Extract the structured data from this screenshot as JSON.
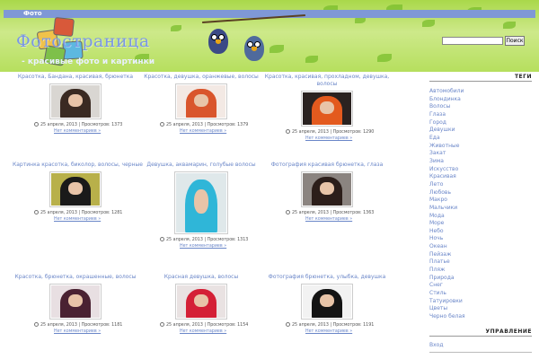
{
  "nav": {
    "items": [
      "Фото"
    ]
  },
  "header": {
    "site_title": "Фотостраница",
    "site_subtitle": "- красивые фото и картинки"
  },
  "search": {
    "placeholder": "",
    "button_label": "Поиск"
  },
  "posts": [
    {
      "title": "Красотка, Бандана, красивая, брюнетка",
      "date": "25 апреля, 2013",
      "views_label": "Просмотров:",
      "views": "1373",
      "comments": "Нет комментариев »",
      "hair_color": "#3a2a22",
      "bg_color": "#d9d6d2"
    },
    {
      "title": "Красотка, девушка, оранжевые, волосы",
      "date": "25 апреля, 2013",
      "views_label": "Просмотров:",
      "views": "1379",
      "comments": "Нет комментариев »",
      "hair_color": "#d9552c",
      "bg_color": "#f3e9e4"
    },
    {
      "title": "Красотка, красивая, прохладном, девушка, волосы",
      "date": "25 апреля, 2013",
      "views_label": "Просмотров:",
      "views": "1290",
      "comments": "Нет комментариев »",
      "hair_color": "#e35a1e",
      "bg_color": "#2a2220"
    },
    {
      "title": "Картинка красотка, биколор, волосы, черные",
      "date": "25 апреля, 2013",
      "views_label": "Просмотров:",
      "views": "1281",
      "comments": "Нет комментариев »",
      "hair_color": "#1a1a1a",
      "bg_color": "#b8b04a"
    },
    {
      "title": "Девушка, аквамарин, голубые волосы",
      "date": "25 апреля, 2013",
      "views_label": "Просмотров:",
      "views": "1313",
      "comments": "Нет комментариев »",
      "hair_color": "#2fb6d8",
      "bg_color": "#dfe8ea"
    },
    {
      "title": "Фотография красивая брюнетка, глаза",
      "date": "25 апреля, 2013",
      "views_label": "Просмотров:",
      "views": "1363",
      "comments": "Нет комментариев »",
      "hair_color": "#2c1e1a",
      "bg_color": "#8b8480"
    },
    {
      "title": "Красотка, брюнетка, окрашенные, волосы",
      "date": "25 апреля, 2013",
      "views_label": "Просмотров:",
      "views": "1181",
      "comments": "Нет комментариев »",
      "hair_color": "#4a2232",
      "bg_color": "#e8dfe2"
    },
    {
      "title": "Красная девушка, волосы",
      "date": "25 апреля, 2013",
      "views_label": "Просмотров:",
      "views": "1154",
      "comments": "Нет комментариев »",
      "hair_color": "#d42036",
      "bg_color": "#e9e2e2"
    },
    {
      "title": "Фотография брюнетка, улыбка, девушка",
      "date": "25 апреля, 2013",
      "views_label": "Просмотров:",
      "views": "1191",
      "comments": "Нет комментариев »",
      "hair_color": "#141414",
      "bg_color": "#f2f2f2"
    }
  ],
  "sidebar": {
    "tags_heading": "ТЕГИ",
    "tags": [
      "Автомобили",
      "Блондинка",
      "Волосы",
      "Глаза",
      "Город",
      "Девушки",
      "Еда",
      "Животные",
      "Закат",
      "Зима",
      "Искусство",
      "Красивая",
      "Лето",
      "Любовь",
      "Макро",
      "Мальчики",
      "Мода",
      "Море",
      "Небо",
      "Ночь",
      "Океан",
      "Пейзаж",
      "Платье",
      "Пляж",
      "Природа",
      "Снег",
      "Стиль",
      "Татуировки",
      "Цветы",
      "Черно белая"
    ],
    "mgmt_heading": "УПРАВЛЕНИЕ",
    "mgmt_items": [
      "Вход"
    ]
  },
  "colors": {
    "accent": "#6a86c8",
    "header_green": "#b6df5e",
    "nav_bar": "#7f98d6"
  }
}
